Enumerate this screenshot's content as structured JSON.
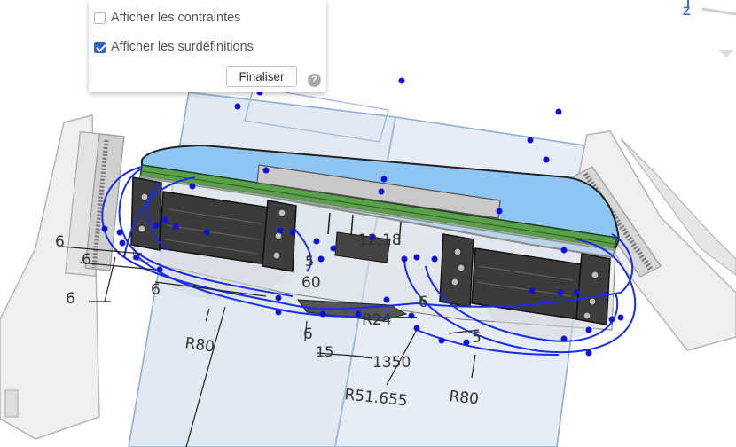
{
  "panel": {
    "show_constraints_label": "Afficher les contraintes",
    "show_constraints_checked": false,
    "show_overdefined_label": "Afficher les surdéfinitions",
    "show_overdefined_checked": true,
    "finalize_label": "Finaliser",
    "help_glyph": "?"
  },
  "triad": {
    "axis_label": "Z"
  },
  "dimensions": {
    "d1": "6",
    "d2": "6",
    "d3": "6",
    "d4": "6",
    "d5": "60",
    "d6": "12.18",
    "d7": "R80",
    "d8": "6",
    "d9": "15",
    "d10": "R24",
    "d11": "1350",
    "d12": "R51.655",
    "d13": "5",
    "d14": "R80",
    "d15": "6",
    "d16": "5"
  },
  "colors": {
    "sketch_curve": "#1a2ee6",
    "sketch_point": "#1010dd",
    "plane_fill": "#c9d8ea",
    "plane_edge": "#8eaed6",
    "pcb_green": "#5aa04a",
    "cover_blue": "#8ec5f2",
    "accent": "#2d62c8"
  }
}
